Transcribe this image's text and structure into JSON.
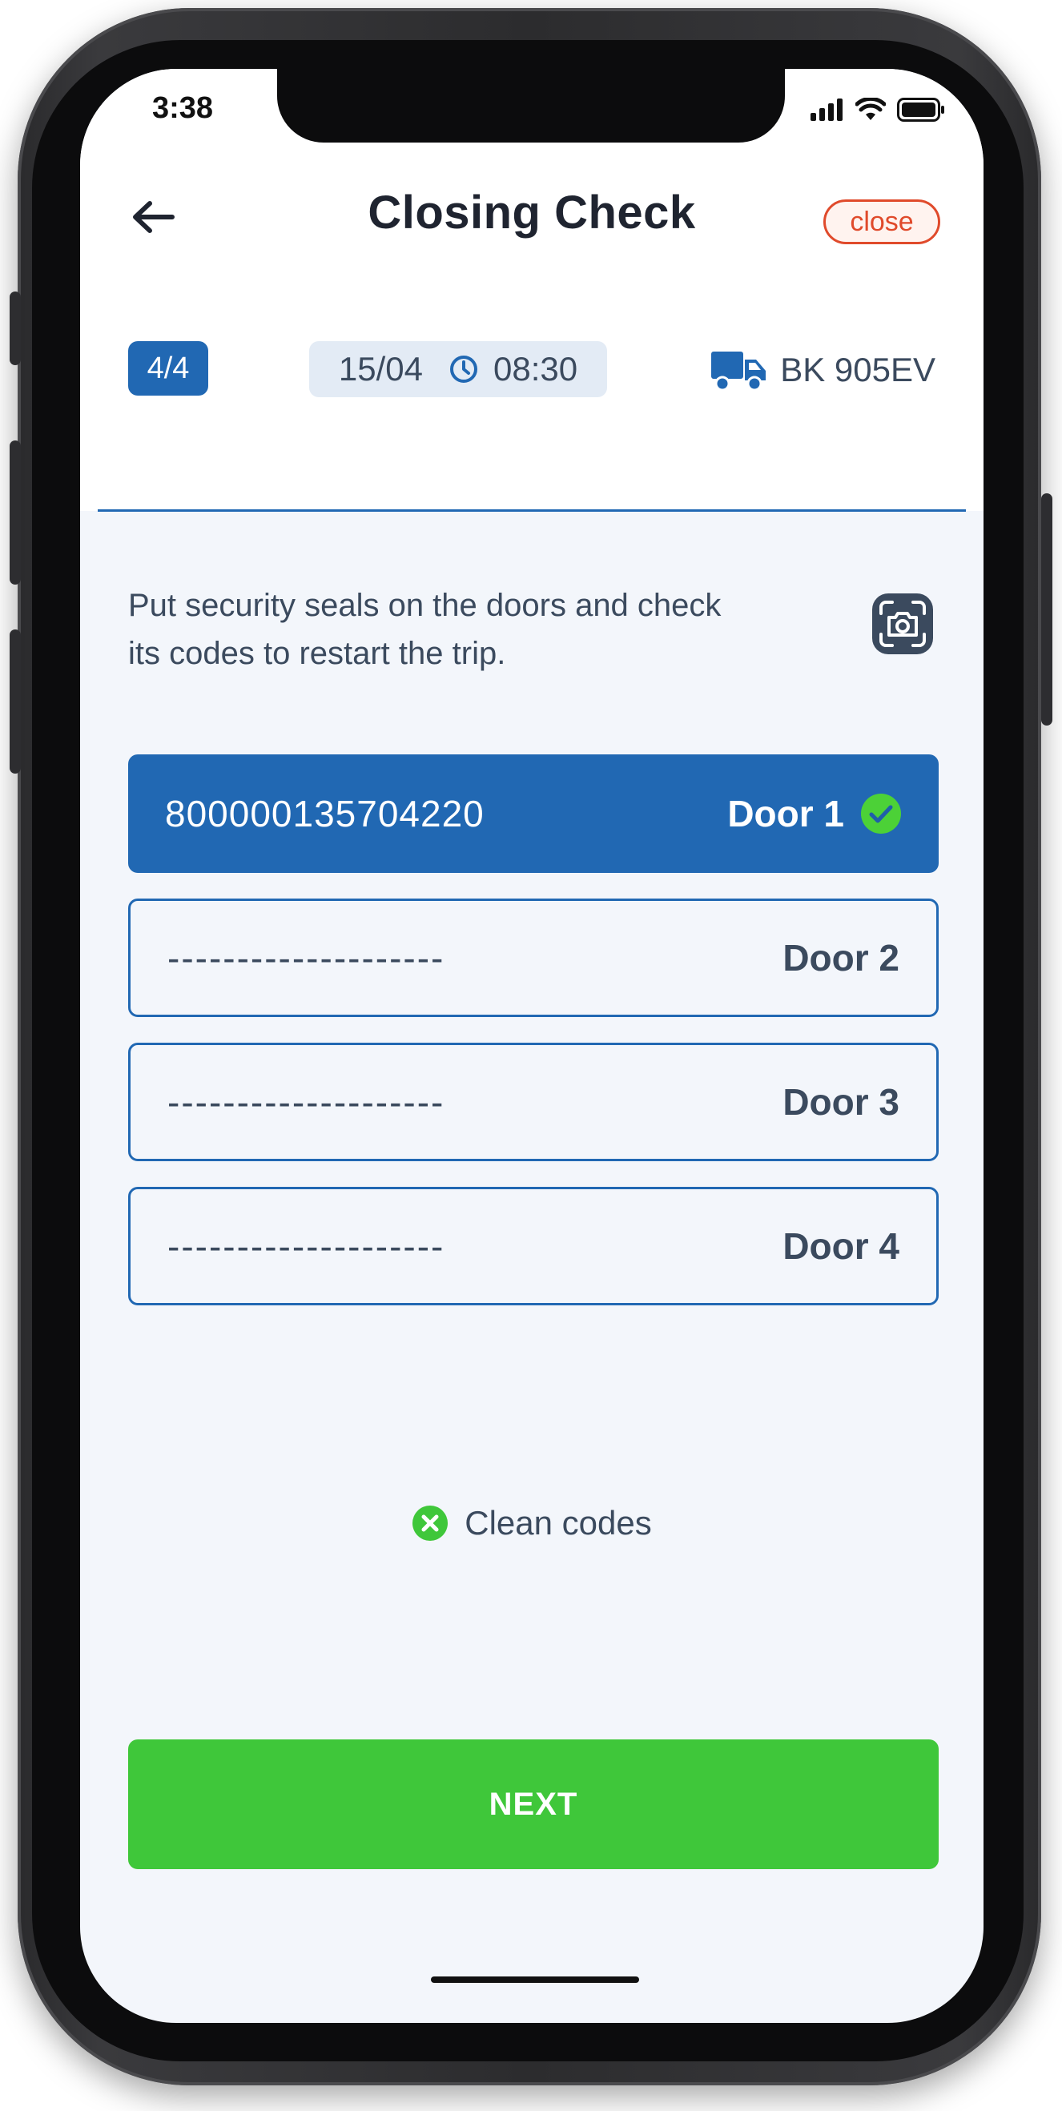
{
  "status_bar": {
    "time": "3:38"
  },
  "header": {
    "title": "Closing Check",
    "close_label": "close",
    "step": "4/4",
    "date": "15/04",
    "time": "08:30",
    "vehicle_plate": "BK 905EV"
  },
  "instructions": "Put security seals on the doors and check its codes to restart the trip.",
  "doors": [
    {
      "code": "800000135704220",
      "label": "Door 1",
      "verified": true
    },
    {
      "code": "--------------------",
      "label": "Door 2",
      "verified": false
    },
    {
      "code": "--------------------",
      "label": "Door 3",
      "verified": false
    },
    {
      "code": "--------------------",
      "label": "Door 4",
      "verified": false
    }
  ],
  "clean_codes_label": "Clean codes",
  "next_label": "NEXT",
  "colors": {
    "primary": "#2168b3",
    "success": "#3fc73a",
    "check_badge": "#4cd137",
    "danger": "#e04a2b",
    "background": "#f3f6fb"
  },
  "icons": {
    "back": "arrow-left-icon",
    "clock": "clock-icon",
    "vehicle": "truck-icon",
    "camera": "camera-scan-icon",
    "verified": "check-circle-icon",
    "clear": "x-circle-icon"
  }
}
